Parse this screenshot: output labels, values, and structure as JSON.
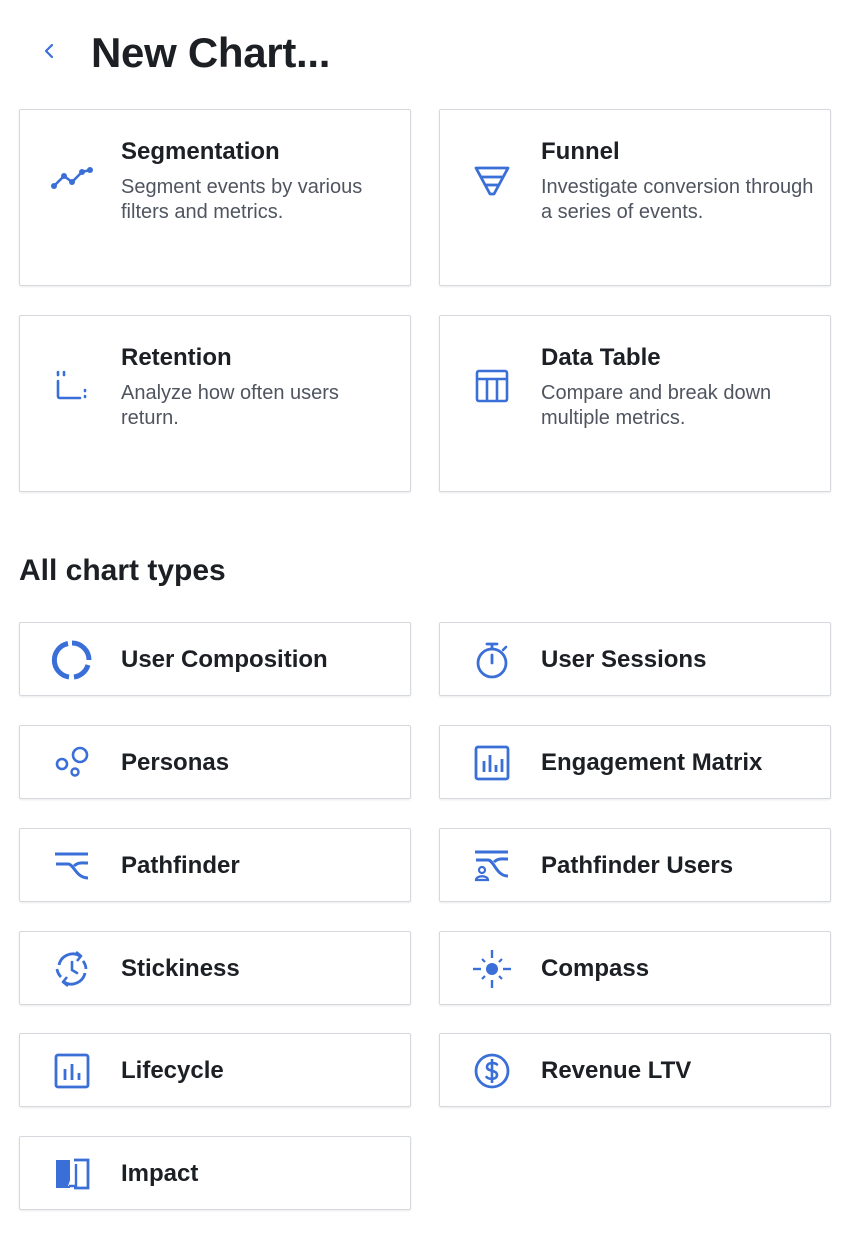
{
  "header": {
    "title": "New Chart..."
  },
  "featured": [
    {
      "title": "Segmentation",
      "description": "Segment events by various filters and metrics.",
      "icon": "segmentation-icon"
    },
    {
      "title": "Funnel",
      "description": "Investigate conversion through a series of events.",
      "icon": "funnel-icon"
    },
    {
      "title": "Retention",
      "description": "Analyze how often users return.",
      "icon": "retention-icon"
    },
    {
      "title": "Data Table",
      "description": "Compare and break down multiple metrics.",
      "icon": "data-table-icon"
    }
  ],
  "all_types": {
    "heading": "All chart types",
    "items": [
      {
        "title": "User Composition",
        "icon": "user-composition-icon"
      },
      {
        "title": "User Sessions",
        "icon": "stopwatch-icon"
      },
      {
        "title": "Personas",
        "icon": "personas-icon"
      },
      {
        "title": "Engagement Matrix",
        "icon": "engagement-matrix-icon"
      },
      {
        "title": "Pathfinder",
        "icon": "pathfinder-icon"
      },
      {
        "title": "Pathfinder Users",
        "icon": "pathfinder-users-icon"
      },
      {
        "title": "Stickiness",
        "icon": "stickiness-icon"
      },
      {
        "title": "Compass",
        "icon": "compass-icon"
      },
      {
        "title": "Lifecycle",
        "icon": "lifecycle-icon"
      },
      {
        "title": "Revenue LTV",
        "icon": "dollar-icon"
      },
      {
        "title": "Impact",
        "icon": "impact-icon"
      }
    ]
  },
  "colors": {
    "accent": "#3a6fd8",
    "text": "#1c1f24",
    "muted": "#4f5560",
    "border": "#d5d8dd"
  }
}
